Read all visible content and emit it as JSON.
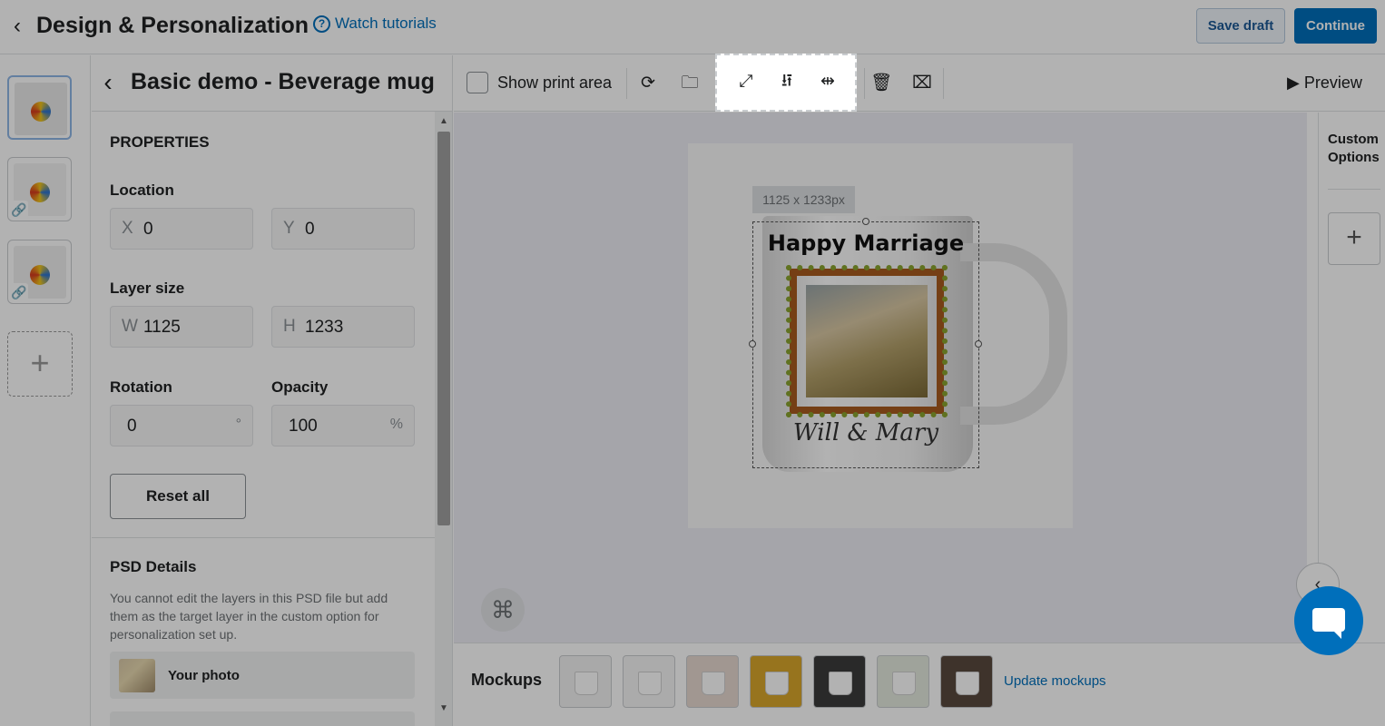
{
  "header": {
    "title": "Design & Personalization",
    "tutorial_link": "Watch tutorials",
    "save_draft": "Save draft",
    "continue": "Continue"
  },
  "panel": {
    "title": "Basic demo - Beverage mug",
    "properties_heading": "PROPERTIES",
    "location_label": "Location",
    "x_prefix": "X",
    "x_value": "0",
    "y_prefix": "Y",
    "y_value": "0",
    "layer_size_label": "Layer size",
    "w_prefix": "W",
    "w_value": "1125",
    "h_prefix": "H",
    "h_value": "1233",
    "rotation_label": "Rotation",
    "rotation_value": "0",
    "rotation_unit": "°",
    "opacity_label": "Opacity",
    "opacity_value": "100",
    "opacity_unit": "%",
    "reset_button": "Reset all",
    "psd_heading": "PSD Details",
    "psd_description": "You cannot edit the layers in this PSD file but add them as the target layer in the custom option for personalization set up.",
    "layer_item": "Your photo"
  },
  "toolbar": {
    "show_print_area": "Show print area",
    "preview": "Preview"
  },
  "canvas": {
    "size_tag": "1125 x 1233px",
    "mug_title": "Happy Marriage",
    "mug_names": "Will & Mary"
  },
  "right_bar": {
    "custom_options": "Custom Options"
  },
  "mockups": {
    "label": "Mockups",
    "update_link": "Update mockups"
  },
  "icons": {
    "back": "chevron-left-icon",
    "help": "question-circle-icon",
    "link": "link-icon",
    "sync": "sync-icon",
    "folder": "folder-sync-icon",
    "fit": "expand-icon",
    "center_v": "align-vertical-center-icon",
    "center_h": "align-horizontal-center-icon",
    "delete": "trash-icon",
    "delete_all": "trash-x-icon",
    "play": "play-icon",
    "plus": "plus-icon",
    "cmd": "command-icon",
    "chat": "chat-icon"
  },
  "colors": {
    "accent": "#006fbb",
    "overlay": "rgba(0,0,0,0.3)"
  }
}
